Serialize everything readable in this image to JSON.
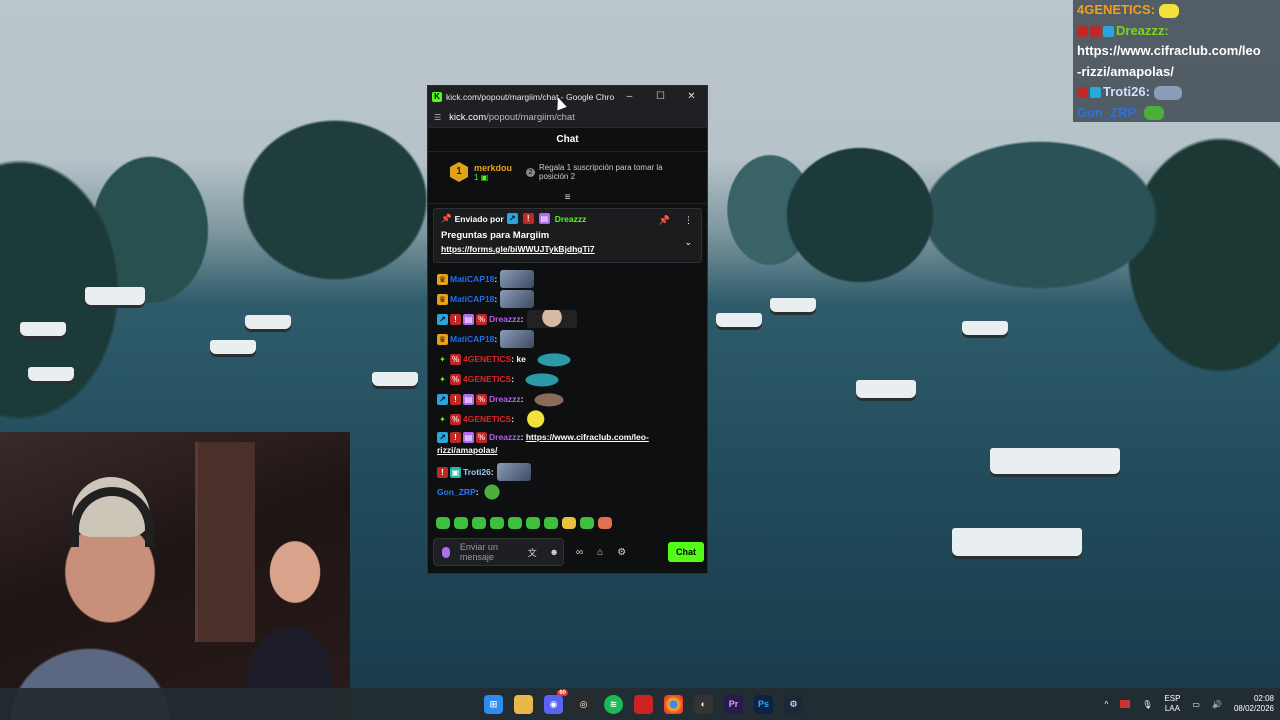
{
  "window": {
    "title": "kick.com/popout/margiim/chat - Google Chro...",
    "url_host": "kick.com",
    "url_path": "/popout/margiim/chat",
    "minimize": "–",
    "maximize": "☐",
    "close": "✕"
  },
  "chat": {
    "header": "Chat",
    "leader": {
      "rank": "1",
      "name": "merkdou",
      "count": "1",
      "gift_rank": "2",
      "gift_text": "Regala 1 suscripción para tomar la posición 2"
    },
    "pinned": {
      "sent_by_label": "Enviado por",
      "sent_by_user": "Dreazzz",
      "title": "Preguntas para Margiim",
      "link": "https://forms.gle/biWWUJTykBjdhgTi7"
    },
    "messages": [
      {
        "user": "MatiCAP18",
        "text": ""
      },
      {
        "user": "MatiCAP18",
        "text": ""
      },
      {
        "user": "Dreazzz",
        "text": ""
      },
      {
        "user": "MatiCAP18",
        "text": ""
      },
      {
        "user": "4GENETICS",
        "text": "ke"
      },
      {
        "user": "4GENETICS",
        "text": ""
      },
      {
        "user": "Dreazzz",
        "text": ""
      },
      {
        "user": "4GENETICS",
        "text": ""
      },
      {
        "user": "Dreazzz",
        "text": "https://www.cifraclub.com/leo-rizzi/amapolas/"
      },
      {
        "user": "Troti26",
        "text": ""
      },
      {
        "user": "Gon_ZRP",
        "text": ""
      }
    ],
    "composer": {
      "placeholder": "Enviar un mensaje",
      "send_label": "Chat"
    }
  },
  "overlay": {
    "lines": [
      {
        "user": "4GENETICS",
        "text": ""
      },
      {
        "user": "Dreazzz",
        "text": "https://www.cifraclub.com/leo"
      },
      {
        "user": "",
        "text": "-rizzi/amapolas/"
      },
      {
        "user": "Troti26",
        "text": ""
      },
      {
        "user": "Gon_ZRP",
        "text": ""
      }
    ]
  },
  "taskbar": {
    "discord_badge": "60",
    "lang_top": "ESP",
    "lang_bottom": "LAA",
    "time": "02:08",
    "date": "08/02/2026",
    "apps": [
      "windows-icon",
      "file-explorer-icon",
      "discord-icon",
      "obs-icon",
      "spotify-icon",
      "gallery-icon",
      "chrome-icon",
      "app-icon",
      "premiere-icon",
      "photoshop-icon",
      "steam-icon"
    ]
  },
  "colors": {
    "kick_green": "#53fc18",
    "accent_purple": "#b06cf0"
  }
}
